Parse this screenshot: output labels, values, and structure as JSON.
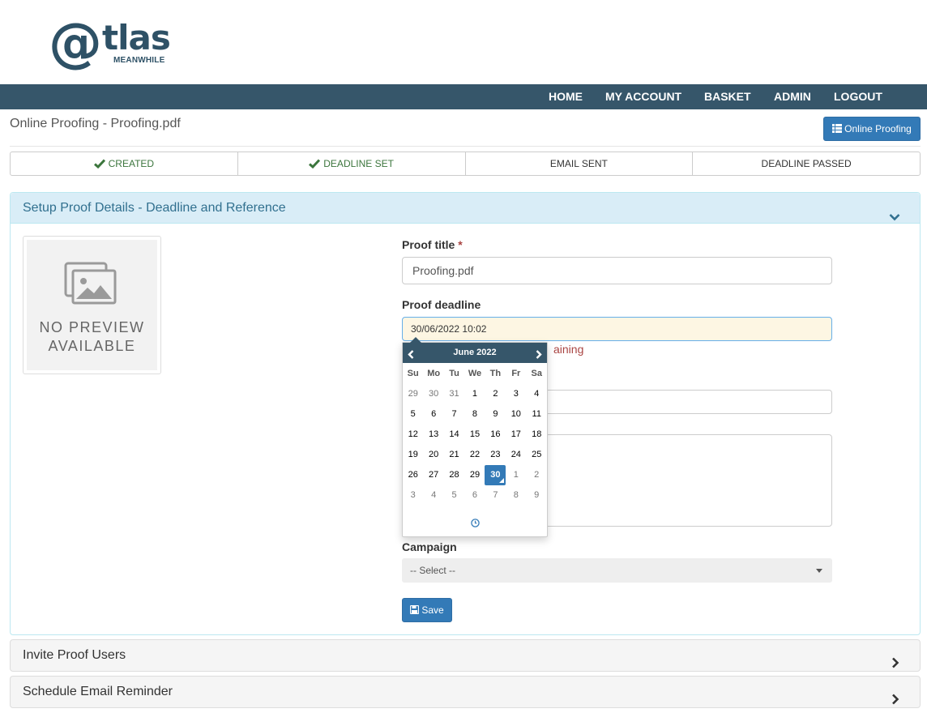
{
  "brand": {
    "symbol": "@",
    "word": "tlas",
    "tagline": "MEANWHILE",
    "color": "#2e5166"
  },
  "nav": {
    "items": [
      "HOME",
      "MY ACCOUNT",
      "BASKET",
      "ADMIN",
      "LOGOUT"
    ]
  },
  "page": {
    "title": "Online Proofing - Proofing.pdf",
    "button_label": "Online Proofing"
  },
  "steps": [
    {
      "label": "CREATED",
      "done": true
    },
    {
      "label": "DEADLINE SET",
      "done": true
    },
    {
      "label": "EMAIL SENT",
      "done": false
    },
    {
      "label": "DEADLINE PASSED",
      "done": false
    }
  ],
  "setup_panel": {
    "title": "Setup Proof Details - Deadline and Reference",
    "preview_text": [
      "NO PREVIEW",
      "AVAILABLE"
    ],
    "proof_title_label": "Proof title",
    "required_marker": "*",
    "proof_title_value": "Proofing.pdf",
    "deadline_label": "Proof deadline",
    "deadline_value": "30/06/2022 10:02",
    "deadline_help_partial": "aining",
    "campaign_label": "Campaign",
    "campaign_selected": "-- Select --",
    "save_label": "Save"
  },
  "datepicker": {
    "month_label": "June 2022",
    "weekdays": [
      "Su",
      "Mo",
      "Tu",
      "We",
      "Th",
      "Fr",
      "Sa"
    ],
    "weeks": [
      [
        "29",
        "30",
        "31",
        "1",
        "2",
        "3",
        "4"
      ],
      [
        "5",
        "6",
        "7",
        "8",
        "9",
        "10",
        "11"
      ],
      [
        "12",
        "13",
        "14",
        "15",
        "16",
        "17",
        "18"
      ],
      [
        "19",
        "20",
        "21",
        "22",
        "23",
        "24",
        "25"
      ],
      [
        "26",
        "27",
        "28",
        "29",
        "30",
        "1",
        "2"
      ],
      [
        "3",
        "4",
        "5",
        "6",
        "7",
        "8",
        "9"
      ]
    ],
    "selected_day": "30"
  },
  "collapsed_panels": [
    "Invite Proof Users",
    "Schedule Email Reminder"
  ],
  "colors": {
    "navbar": "#36566a",
    "primary": "#337ab7",
    "success": "#3c763d",
    "danger": "#a94442",
    "info_bg": "#d9edf7"
  }
}
